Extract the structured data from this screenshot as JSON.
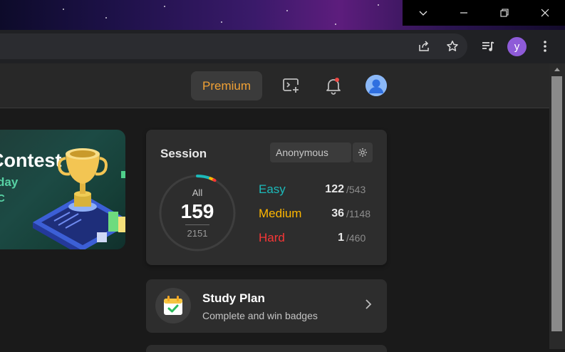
{
  "nav": {
    "premium_label": "Premium"
  },
  "browser": {
    "profile_initial": "y"
  },
  "contest": {
    "title": "Contest",
    "subtitle": "day",
    "extra": "C"
  },
  "session": {
    "title": "Session",
    "selected_session": "Anonymous",
    "all_label": "All",
    "solved": "159",
    "total": "2151",
    "solved_fraction": 0.0739,
    "difficulties": [
      {
        "label": "Easy",
        "solved": "122",
        "total": "/543",
        "color": "#2cbb5d"
      },
      {
        "label": "Medium",
        "solved": "36",
        "total": "/1148",
        "color": "#ffb800"
      },
      {
        "label": "Hard",
        "solved": "1",
        "total": "/460",
        "color": "#ef4743"
      }
    ]
  },
  "study_plan": {
    "title": "Study Plan",
    "subtitle": "Complete and win badges"
  },
  "colors": {
    "easy": "#1cbaba",
    "medium": "#ffb700",
    "hard": "#f63636",
    "premium": "#f0a135"
  }
}
